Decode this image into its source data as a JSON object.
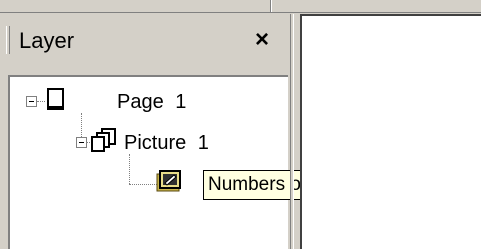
{
  "panel": {
    "title": "Layer",
    "close_label": "×"
  },
  "tree": {
    "nodes": [
      {
        "label": "Page 1",
        "icon": "page-icon",
        "expanded": true
      },
      {
        "label": "Picture 1",
        "icon": "picture-icon",
        "expanded": true
      },
      {
        "icon": "nodes-layer-icon"
      }
    ]
  },
  "tooltip": {
    "text": "Numbers of nodes"
  }
}
